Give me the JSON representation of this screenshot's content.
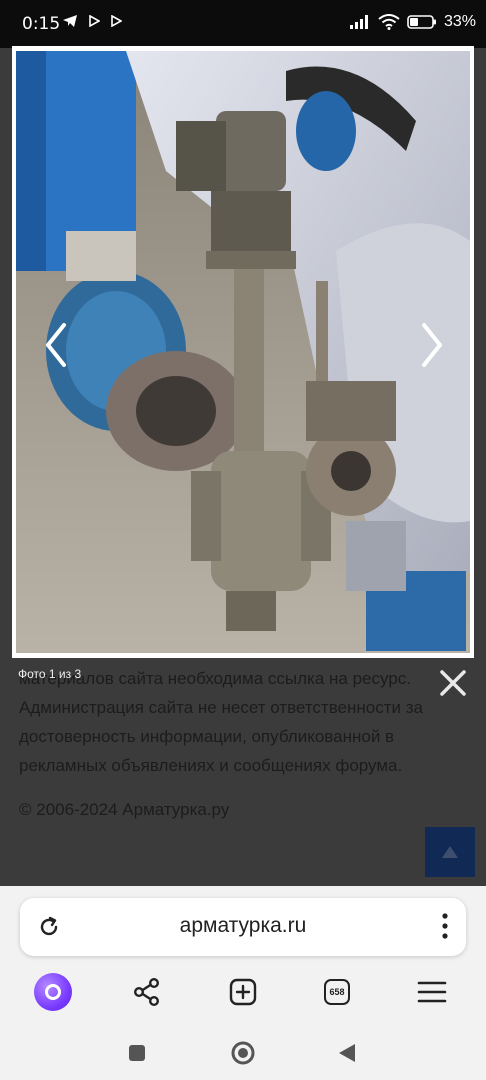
{
  "status_bar": {
    "time": "0:15",
    "battery": "33%",
    "icons": [
      "telegram-icon",
      "play-icon",
      "play-icon",
      "signal-icon",
      "wifi-icon",
      "battery-icon"
    ]
  },
  "viewer": {
    "counter": "Фото 1 из 3",
    "prev_icon": "chevron-left-icon",
    "next_icon": "chevron-right-icon",
    "close_icon": "close-icon"
  },
  "page": {
    "paragraph_lines": [
      "материалов сайта необходима ссылка на ресурс.",
      "Администрация сайта не несет ответственности за",
      "достоверность информации, опубликованной в",
      "рекламных объявлениях и сообщениях форума."
    ],
    "copyright": "© 2006-2024 Арматурка.ру",
    "up_icon": "arrow-up-icon"
  },
  "browser": {
    "url": "арматурка.ru",
    "tabs_count": "658",
    "accent_color": "#7a3cff"
  }
}
